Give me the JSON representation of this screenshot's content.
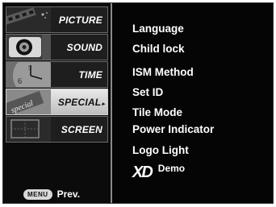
{
  "sidebar": {
    "tabs": [
      {
        "label": "PICTURE",
        "icon": "picture-icon",
        "active": false
      },
      {
        "label": "SOUND",
        "icon": "speaker-icon",
        "active": false
      },
      {
        "label": "TIME",
        "icon": "clock-icon",
        "active": false
      },
      {
        "label": "SPECIAL",
        "icon": "special-icon",
        "active": true
      },
      {
        "label": "SCREEN",
        "icon": "screen-icon",
        "active": false
      }
    ],
    "active_arrow": "▸",
    "menu_key": "MENU",
    "prev_label": "Prev."
  },
  "menu": {
    "items": [
      "Language",
      "Child lock",
      "ISM Method",
      "Set ID",
      "Tile Mode",
      "Power Indicator",
      "Logo Light"
    ],
    "xd_logo": "XD",
    "demo_label": "Demo"
  },
  "colors": {
    "background": "#050505",
    "text": "#ffffff",
    "active_tab": "#d9d9d9"
  }
}
